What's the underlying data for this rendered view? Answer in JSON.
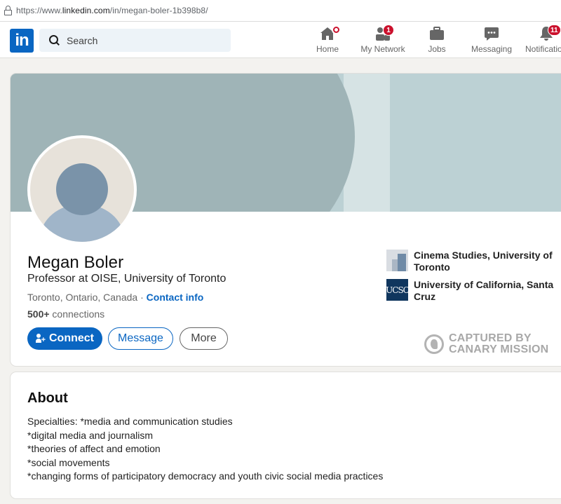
{
  "browser": {
    "url_prefix": "https://www.",
    "url_domain": "linkedin.com",
    "url_path": "/in/megan-boler-1b398b8/"
  },
  "nav": {
    "logo": "in",
    "search_placeholder": "Search",
    "items": [
      {
        "label": "Home",
        "icon": "home-icon"
      },
      {
        "label": "My Network",
        "icon": "network-icon",
        "badge": "1"
      },
      {
        "label": "Jobs",
        "icon": "briefcase-icon"
      },
      {
        "label": "Messaging",
        "icon": "messaging-icon"
      },
      {
        "label": "Notifications",
        "icon": "bell-icon",
        "badge": "11"
      }
    ]
  },
  "profile": {
    "name": "Megan Boler",
    "headline": "Professor at OISE, University of Toronto",
    "location": "Toronto, Ontario, Canada",
    "separator": " · ",
    "contact_info": "Contact info",
    "connections_count": "500+",
    "connections_label": " connections",
    "buttons": {
      "connect": "Connect",
      "message": "Message",
      "more": "More"
    },
    "education": [
      {
        "name": "Cinema Studies, University of Toronto"
      },
      {
        "name": "University of California, Santa Cruz",
        "logo_text": "UCSC"
      }
    ]
  },
  "watermark": {
    "line1": "CAPTURED BY",
    "line2": "CANARY MISSION"
  },
  "about": {
    "title": "About",
    "text": "Specialties: *media and communication studies\n*digital media and journalism\n*theories of affect and emotion\n*social movements\n*changing forms of participatory democracy and youth civic social media practices"
  },
  "colors": {
    "brand": "#0a66c2",
    "badge": "#cb112d",
    "banner": "#bcd1d4"
  }
}
